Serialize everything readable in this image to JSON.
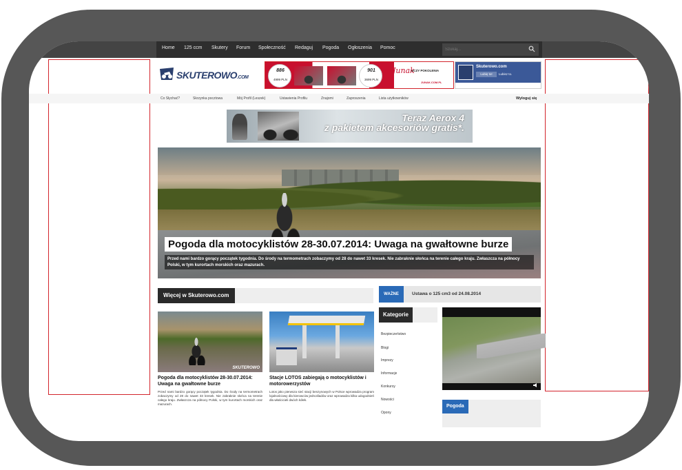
{
  "nav": {
    "items": [
      "Home",
      "125 ccm",
      "Skutery",
      "Forum",
      "Społeczność",
      "Redaguj",
      "Pogoda",
      "Ogłoszenia",
      "Pomoc"
    ],
    "search_placeholder": "Szukaj..."
  },
  "logo": {
    "text": "SKUTEROWO",
    "suffix": ".COM"
  },
  "ad": {
    "model1": "886",
    "price1": "4999 PLN",
    "model2": "901",
    "price2": "3699 PLN",
    "brand": "Junak",
    "slogan": "UCZY POKOLENIA",
    "url": "JUNAK.COM.PL"
  },
  "facebook": {
    "title": "Skuterowo.com",
    "like_label": "Lubię to!",
    "count_text": "Lubisz to."
  },
  "subnav": {
    "items": [
      "Co Słychać?",
      "Skrzynka pocztowa",
      "Mój Profil (Leszek)",
      "Ustawienia Profilu",
      "Znajomi",
      "Zaproszenia",
      "Lista użytkowników"
    ],
    "logout": "Wyloguj się"
  },
  "aerox": {
    "line1": "Teraz Aerox 4",
    "line2": "z pakietem akcesoriów gratis*."
  },
  "hero": {
    "title": "Pogoda dla motocyklistów 28-30.07.2014: Uwaga na gwałtowne burze",
    "excerpt": "Przed nami bardzo gorący początek tygodnia. Do środy na termometrach zobaczymy od 28 do nawet 33 kresek. Nie zabraknie słońca na terenie całego kraju. Zwłaszcza na północy Polski, w tym kurortach morskich oraz mazurach."
  },
  "section": {
    "title": "Więcej w Skuterowo.com"
  },
  "wazne": {
    "tag": "WAŻNE",
    "text": "Ustawa o 125 cm3 od 24.08.2014"
  },
  "cards": [
    {
      "title": "Pogoda dla motocyklistów 28-30.07.2014: Uwaga na gwałtowne burze",
      "excerpt": "Przed nami bardzo gorący początek tygodnia. Do środy na termometrach zobaczymy od 28 do nawet 33 kresek. Nie zabraknie słońca na terenie całego kraju. Zwłaszcza na północy Polski, w tym kurortach morskich oraz mazurach.",
      "watermark": "SKUTEROWO"
    },
    {
      "title": "Stacje LOTOS zabiegają o motocyklistów i motorowerzystów",
      "excerpt": "Lotos jako pierwsza sieć stacji benzynowych w Polsce wprowadza program lojalnościowy dla kierowców jednośladów oraz wprowadza kilka udogodnień dla właścicieli dwóch kółek.",
      "watermark": ""
    }
  ],
  "categories": {
    "title": "Kategorie",
    "items": [
      "Bezpieczeństwo",
      "Blogi",
      "Imprezy",
      "Informacje",
      "Konkursy",
      "Nowości",
      "Opony"
    ]
  },
  "pogoda": {
    "title": "Pogoda"
  },
  "colors": {
    "frame": "#575757",
    "accent_red": "#d2232a",
    "accent_blue": "#2a6ab7",
    "nav_dark": "#2e2e2e"
  },
  "icons": {
    "search": "search-icon",
    "video": "volume-icon"
  }
}
